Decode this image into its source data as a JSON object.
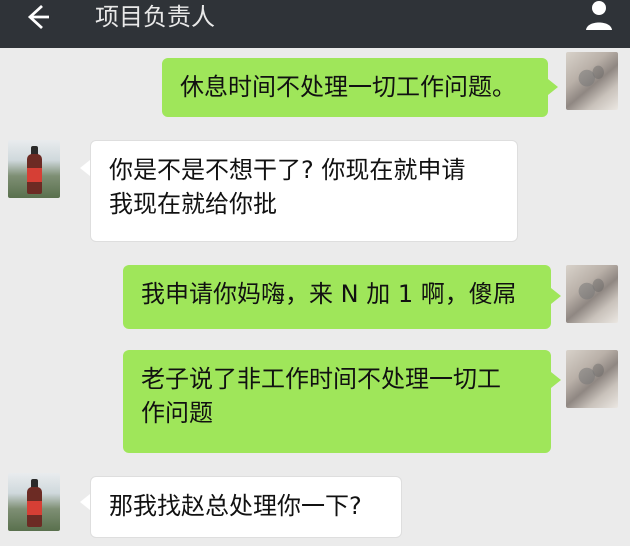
{
  "header": {
    "title": "项目负责人",
    "back_icon": "arrow-left-icon",
    "profile_icon": "person-icon"
  },
  "colors": {
    "topbar": "#2f3338",
    "background": "#ebebeb",
    "my_bubble": "#9fe65a",
    "other_bubble": "#ffffff"
  },
  "messages": [
    {
      "sender": "me",
      "lines": [
        "休息时间不处理一切工作问题。"
      ]
    },
    {
      "sender": "other",
      "lines": [
        "你是不是不想干了? 你现在就申请",
        "我现在就给你批"
      ]
    },
    {
      "sender": "me",
      "lines": [
        "我申请你妈嗨，来 N 加 1 啊，傻屌"
      ]
    },
    {
      "sender": "me",
      "lines": [
        "老子说了非工作时间不处理一切工",
        "作问题"
      ]
    },
    {
      "sender": "other",
      "lines": [
        "那我找赵总处理你一下?"
      ]
    }
  ]
}
